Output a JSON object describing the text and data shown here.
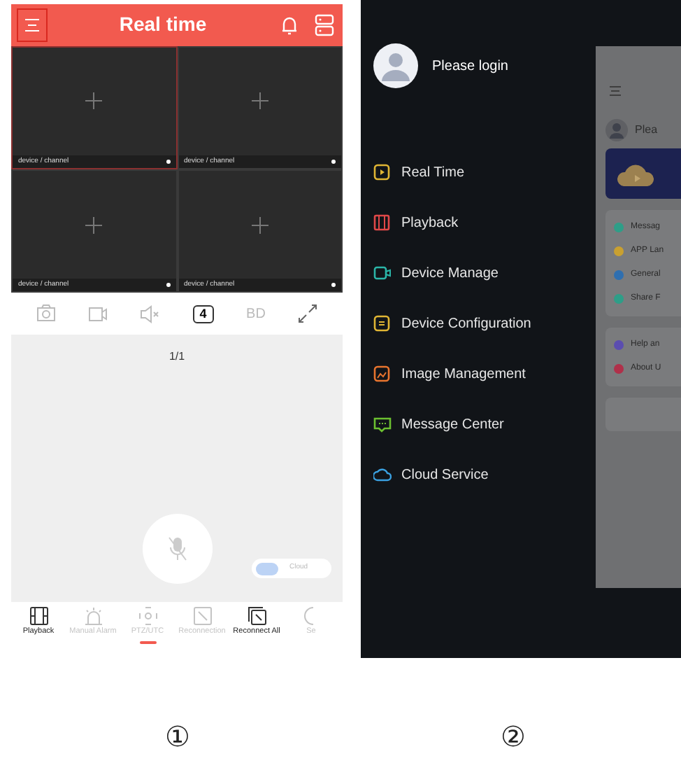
{
  "left_phone": {
    "header": {
      "title": "Real time"
    },
    "cells": [
      {
        "label": "device / channel",
        "selected": true
      },
      {
        "label": "device / channel",
        "selected": false
      },
      {
        "label": "device / channel",
        "selected": false
      },
      {
        "label": "device / channel",
        "selected": false
      }
    ],
    "toolbar": [
      {
        "kind": "snapshot"
      },
      {
        "kind": "record"
      },
      {
        "kind": "mute"
      },
      {
        "kind": "split",
        "text": "4"
      },
      {
        "kind": "quality",
        "text": "BD"
      },
      {
        "kind": "fullscreen"
      }
    ],
    "page_indicator": "1/1",
    "cloud_toggle": {
      "label": "Cloud",
      "on": false
    },
    "nav": [
      {
        "kind": "playback",
        "label": "Playback",
        "disabled": false,
        "selected": false
      },
      {
        "kind": "alarm",
        "label": "Manual Alarm",
        "disabled": true,
        "selected": false
      },
      {
        "kind": "ptz",
        "label": "PTZ/UTC",
        "disabled": true,
        "selected": true
      },
      {
        "kind": "reconnect",
        "label": "Reconnection",
        "disabled": true,
        "selected": false
      },
      {
        "kind": "reconnect_all",
        "label": "Reconnect All",
        "disabled": false,
        "selected": false
      },
      {
        "kind": "settings",
        "label": "Se",
        "disabled": true,
        "selected": false
      }
    ]
  },
  "right_phone": {
    "user": "Please login",
    "menu": [
      {
        "kind": "play",
        "label": "Real Time",
        "color": "#e0b534"
      },
      {
        "kind": "film",
        "label": "Playback",
        "color": "#e04848"
      },
      {
        "kind": "camera",
        "label": "Device Manage",
        "color": "#2bb5a8"
      },
      {
        "kind": "config",
        "label": "Device Configuration",
        "color": "#e0b534"
      },
      {
        "kind": "image",
        "label": "Image Management",
        "color": "#e8742e"
      },
      {
        "kind": "message",
        "label": "Message Center",
        "color": "#6cc030"
      },
      {
        "kind": "cloud",
        "label": "Cloud Service",
        "color": "#3aa0e0"
      }
    ],
    "behind": {
      "user": "Plea",
      "list1": [
        {
          "label": "Messag",
          "color": "#2e9e88"
        },
        {
          "label": "APP Lan",
          "color": "#c9a030"
        },
        {
          "label": "General",
          "color": "#2f6fb0"
        },
        {
          "label": "Share F",
          "color": "#2e9e88"
        }
      ],
      "list2": [
        {
          "label": "Help an",
          "color": "#5b4db0"
        },
        {
          "label": "About U",
          "color": "#b0304a"
        }
      ]
    }
  },
  "captions": [
    "①",
    "②"
  ]
}
